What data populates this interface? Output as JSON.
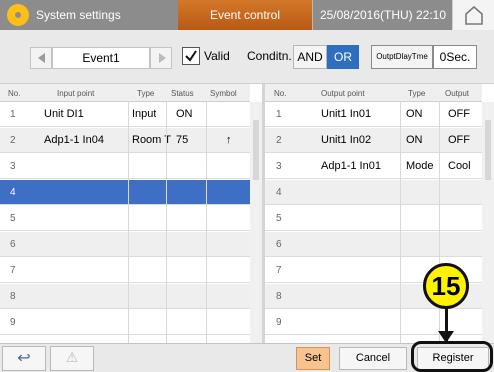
{
  "header": {
    "app_title": "System settings",
    "screen_title": "Event control",
    "datetime": "25/08/2016(THU) 22:10"
  },
  "toolbar": {
    "event_name": "Event1",
    "valid_label": "Valid",
    "valid_checked": true,
    "condition_label": "Conditn.",
    "and_label": "AND",
    "or_label": "OR",
    "selected_condition": "OR",
    "output_delay_label": "OutptDlayTme",
    "output_delay_value": "0Sec."
  },
  "input_table": {
    "headers": [
      "No.",
      "Input point",
      "Type",
      "Status",
      "Symbol"
    ],
    "rows": [
      {
        "no": "1",
        "point": "Unit DI1",
        "type": "Input",
        "status": "ON",
        "symbol": ""
      },
      {
        "no": "2",
        "point": "Adp1-1 In04",
        "type": "Room T",
        "status": "75",
        "symbol": "↑"
      },
      {
        "no": "3",
        "point": "",
        "type": "",
        "status": "",
        "symbol": ""
      },
      {
        "no": "4",
        "point": "",
        "type": "",
        "status": "",
        "symbol": ""
      },
      {
        "no": "5",
        "point": "",
        "type": "",
        "status": "",
        "symbol": ""
      },
      {
        "no": "6",
        "point": "",
        "type": "",
        "status": "",
        "symbol": ""
      },
      {
        "no": "7",
        "point": "",
        "type": "",
        "status": "",
        "symbol": ""
      },
      {
        "no": "8",
        "point": "",
        "type": "",
        "status": "",
        "symbol": ""
      },
      {
        "no": "9",
        "point": "",
        "type": "",
        "status": "",
        "symbol": ""
      }
    ],
    "selected_row": "4"
  },
  "output_table": {
    "headers": [
      "No.",
      "Output point",
      "Type",
      "Output"
    ],
    "rows": [
      {
        "no": "1",
        "point": "Unit1 In01",
        "type": "ON",
        "output": "OFF"
      },
      {
        "no": "2",
        "point": "Unit1 In02",
        "type": "ON",
        "output": "OFF"
      },
      {
        "no": "3",
        "point": "Adp1-1 In01",
        "type": "Mode",
        "output": "Cool"
      },
      {
        "no": "4",
        "point": "",
        "type": "",
        "output": ""
      },
      {
        "no": "5",
        "point": "",
        "type": "",
        "output": ""
      },
      {
        "no": "6",
        "point": "",
        "type": "",
        "output": ""
      },
      {
        "no": "7",
        "point": "",
        "type": "",
        "output": ""
      },
      {
        "no": "8",
        "point": "",
        "type": "",
        "output": ""
      },
      {
        "no": "9",
        "point": "",
        "type": "",
        "output": ""
      }
    ]
  },
  "footer": {
    "back_icon": "↩",
    "warning_icon": "⚠",
    "set_label": "Set",
    "cancel_label": "Cancel",
    "register_label": "Register"
  },
  "callout": {
    "number": "15"
  },
  "colors": {
    "header_accent": "#c8661d",
    "selected_row": "#3f6fc4",
    "or_active": "#2f6dbf",
    "set_button": "#f7c38e",
    "callout_badge": "#fff200"
  }
}
